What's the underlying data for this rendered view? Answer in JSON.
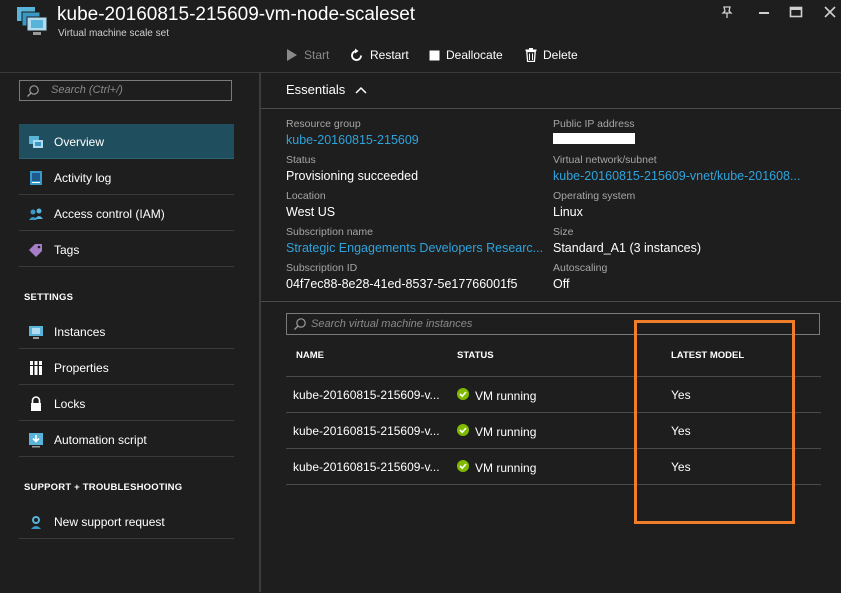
{
  "window": {
    "title": "kube-20160815-215609-vm-node-scaleset",
    "subtitle": "Virtual machine scale set",
    "controls": [
      "pin-icon",
      "minimize-icon",
      "maximize-icon",
      "close-icon"
    ]
  },
  "toolbar": {
    "start_label": "Start",
    "restart_label": "Restart",
    "deallocate_label": "Deallocate",
    "delete_label": "Delete"
  },
  "sidebar": {
    "search_placeholder": "Search (Ctrl+/)",
    "items": [
      {
        "label": "Overview",
        "icon": "overview-icon",
        "active": true
      },
      {
        "label": "Activity log",
        "icon": "activity-log-icon"
      },
      {
        "label": "Access control (IAM)",
        "icon": "iam-icon"
      },
      {
        "label": "Tags",
        "icon": "tag-icon"
      }
    ],
    "settings_header": "SETTINGS",
    "settings_items": [
      {
        "label": "Instances",
        "icon": "instances-icon"
      },
      {
        "label": "Properties",
        "icon": "properties-icon"
      },
      {
        "label": "Locks",
        "icon": "lock-icon"
      },
      {
        "label": "Automation script",
        "icon": "automation-icon"
      }
    ],
    "support_header": "SUPPORT + TROUBLESHOOTING",
    "support_items": [
      {
        "label": "New support request",
        "icon": "support-icon"
      }
    ]
  },
  "essentials": {
    "header": "Essentials",
    "left": [
      {
        "label": "Resource group",
        "value": "kube-20160815-215609",
        "link": true
      },
      {
        "label": "Status",
        "value": "Provisioning succeeded",
        "link": false
      },
      {
        "label": "Location",
        "value": "West US",
        "link": false
      },
      {
        "label": "Subscription name",
        "value": "Strategic Engagements Developers Researc...",
        "link": true
      },
      {
        "label": "Subscription ID",
        "value": "04f7ec88-8e28-41ed-8537-5e17766001f5",
        "link": false
      }
    ],
    "right": [
      {
        "label": "Public IP address",
        "value": "",
        "link": false
      },
      {
        "label": "Virtual network/subnet",
        "value": "kube-20160815-215609-vnet/kube-201608...",
        "link": true
      },
      {
        "label": "Operating system",
        "value": "Linux",
        "link": false
      },
      {
        "label": "Size",
        "value": "Standard_A1 (3 instances)",
        "link": false
      },
      {
        "label": "Autoscaling",
        "value": "Off",
        "link": false
      }
    ]
  },
  "instances": {
    "search_placeholder": "Search virtual machine instances",
    "columns": [
      "NAME",
      "STATUS",
      "LATEST MODEL"
    ],
    "rows": [
      {
        "name": "kube-20160815-215609-v...",
        "status": "VM running",
        "latest_model": "Yes"
      },
      {
        "name": "kube-20160815-215609-v...",
        "status": "VM running",
        "latest_model": "Yes"
      },
      {
        "name": "kube-20160815-215609-v...",
        "status": "VM running",
        "latest_model": "Yes"
      }
    ]
  },
  "colors": {
    "background": "#1e1e1e",
    "link": "#2fa3dc",
    "active_nav": "#1f4f5e",
    "highlight": "#f07d2a",
    "status_ok": "#7fba00"
  }
}
